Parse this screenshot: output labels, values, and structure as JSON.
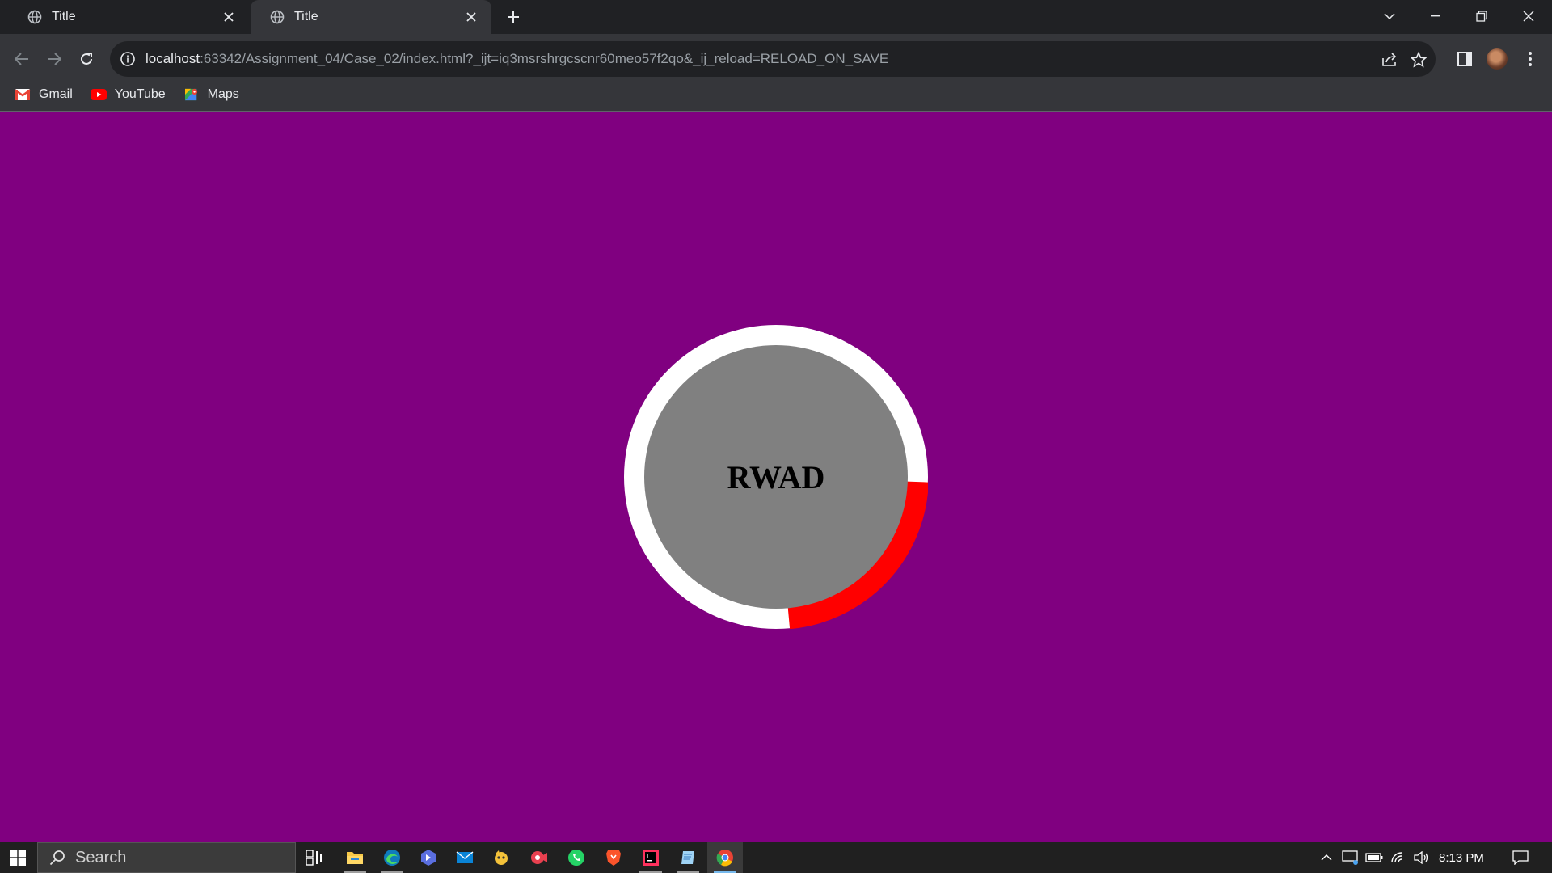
{
  "browser": {
    "tabs": [
      {
        "title": "Title",
        "active": false
      },
      {
        "title": "Title",
        "active": true
      }
    ],
    "url_host": "localhost",
    "url_rest": ":63342/Assignment_04/Case_02/index.html?_ijt=iq3msrshrgcscnr60meo57f2qo&_ij_reload=RELOAD_ON_SAVE",
    "bookmarks": [
      {
        "label": "Gmail",
        "icon": "gmail-icon"
      },
      {
        "label": "YouTube",
        "icon": "youtube-icon"
      },
      {
        "label": "Maps",
        "icon": "maps-icon"
      }
    ]
  },
  "page": {
    "background": "#800080",
    "center_label": "RWAD",
    "ring_color": "#ffffff",
    "progress_color": "#ff0000",
    "inner_color": "#808080",
    "progress_fraction": 0.23
  },
  "taskbar": {
    "search_placeholder": "Search",
    "clock": "8:13 PM",
    "apps": [
      {
        "name": "task-view-icon"
      },
      {
        "name": "file-explorer-icon"
      },
      {
        "name": "edge-icon"
      },
      {
        "name": "power-automate-icon"
      },
      {
        "name": "mail-icon"
      },
      {
        "name": "game-app-icon"
      },
      {
        "name": "camera-icon"
      },
      {
        "name": "whatsapp-icon"
      },
      {
        "name": "brave-icon"
      },
      {
        "name": "intellij-icon"
      },
      {
        "name": "notepad-icon"
      },
      {
        "name": "chrome-icon"
      }
    ]
  }
}
